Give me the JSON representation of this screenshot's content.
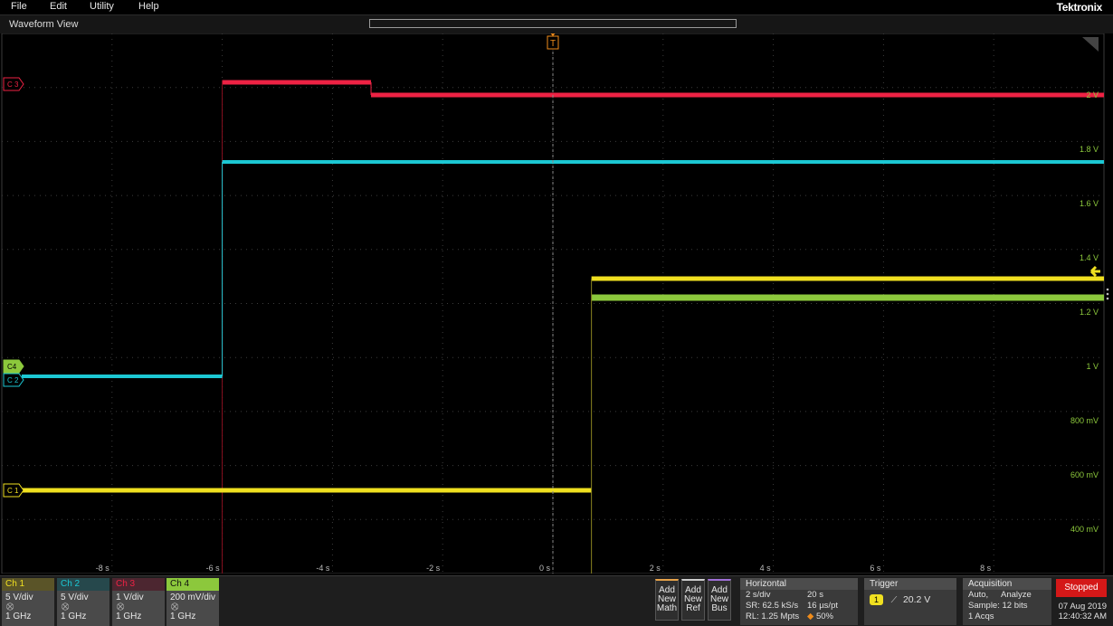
{
  "menu": {
    "file": "File",
    "edit": "Edit",
    "utility": "Utility",
    "help": "Help",
    "brand": "Tektronix"
  },
  "view": {
    "title": "Waveform View"
  },
  "markers": {
    "trigger_pos": "T",
    "record_pos": "U"
  },
  "axes": {
    "x_ticks": [
      "-8 s",
      "-6 s",
      "-4 s",
      "-2 s",
      "0 s",
      "2 s",
      "4 s",
      "6 s",
      "8 s"
    ],
    "y_ticks": [
      "2 V",
      "1.8 V",
      "1.6 V",
      "1.4 V",
      "1.2 V",
      "1 V",
      "800 mV",
      "600 mV",
      "400 mV"
    ]
  },
  "channels": [
    {
      "label": "C 1",
      "name": "Ch 1",
      "vdiv": "5 V/div",
      "bw": "1 GHz",
      "color": "#f0e020",
      "probe": "⛒"
    },
    {
      "label": "C 2",
      "name": "Ch 2",
      "vdiv": "5 V/div",
      "bw": "1 GHz",
      "color": "#1cc8d4",
      "probe": "⛒"
    },
    {
      "label": "C 3",
      "name": "Ch 3",
      "vdiv": "1 V/div",
      "bw": "1 GHz",
      "color": "#ee2244",
      "probe": "⛒"
    },
    {
      "label": "C4",
      "name": "Ch 4",
      "vdiv": "200 mV/div",
      "bw": "1 GHz",
      "color": "#8cc83c",
      "probe": "⛒"
    }
  ],
  "add": {
    "math": {
      "l1": "Add",
      "l2": "New",
      "l3": "Math"
    },
    "ref": {
      "l1": "Add",
      "l2": "New",
      "l3": "Ref"
    },
    "bus": {
      "l1": "Add",
      "l2": "New",
      "l3": "Bus"
    }
  },
  "horizontal": {
    "title": "Horizontal",
    "sdiv": "2 s/div",
    "dur": "20 s",
    "sr": "SR: 62.5 kS/s",
    "pt": "16 µs/pt",
    "rl": "RL: 1.25 Mpts",
    "pos": "50%"
  },
  "trigger": {
    "title": "Trigger",
    "source": "1",
    "level": "20.2 V"
  },
  "acquisition": {
    "title": "Acquisition",
    "mode": "Auto,",
    "analyze": "Analyze",
    "sample": "Sample: 12 bits",
    "acqs": "1 Acqs"
  },
  "status": {
    "stopped": "Stopped",
    "date": "07 Aug 2019",
    "time": "12:40:32 AM"
  },
  "colors": {
    "grid": "#3a3a3a",
    "trigger": "#f08c1a",
    "yaxis_label": "#8cc83c"
  },
  "waveforms": {
    "t_range_s": [
      -10,
      10
    ],
    "ch3_volts": {
      "before_-6s": "off-screen",
      "-6s_to_-3.3s": 2.23,
      "after_-3.3s": 2.0
    },
    "ch2_volts": {
      "before_-6s": 0.97,
      "after_-6s": 1.76
    },
    "ch4_volts": {
      "before_0.7s": "off-screen",
      "after_0.7s": 1.25
    },
    "ch1_volts": {
      "before_0.7s": 0.54,
      "after_0.7s": 1.33
    }
  }
}
